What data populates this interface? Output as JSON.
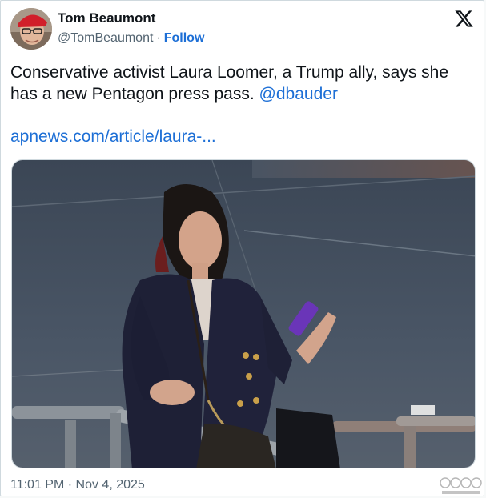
{
  "author": {
    "name": "Tom Beaumont",
    "handle": "@TomBeaumont",
    "separator": "·",
    "follow_label": "Follow",
    "avatar_icon": "person-avatar"
  },
  "brand": {
    "icon": "x-logo-icon"
  },
  "tweet": {
    "text": "Conservative activist Laura Loomer, a Trump ally, says she has a new Pentagon press pass.",
    "mention": "@dbauder",
    "link_text": "apnews.com/article/laura-..."
  },
  "media": {
    "type": "photo"
  },
  "meta": {
    "timestamp": "11:01 PM · Nov 4, 2025"
  },
  "colors": {
    "link": "#1d6fd6",
    "text": "#0f1419",
    "secondary": "#536471",
    "border": "#cfd9de"
  }
}
